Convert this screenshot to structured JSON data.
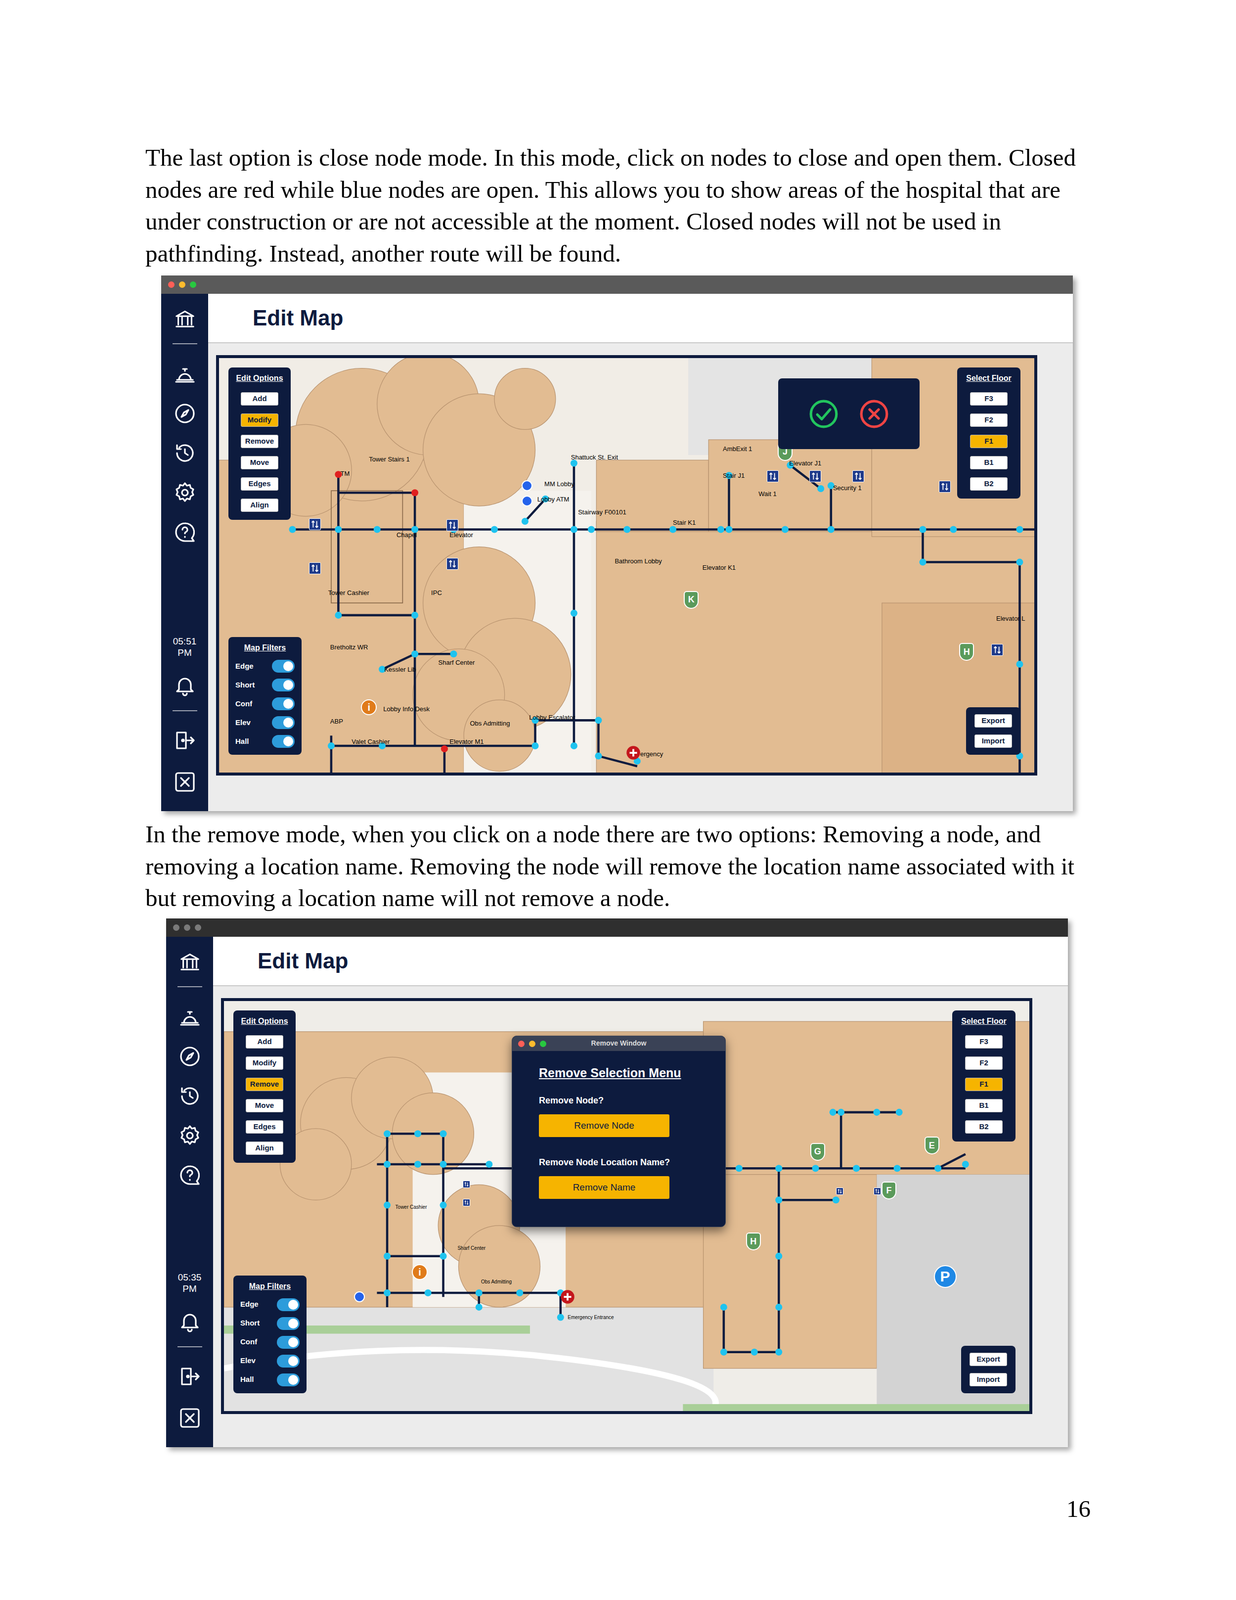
{
  "paragraphs": [
    [
      "The last option is close node mode. In this mode, click on nodes to close and open them. Closed",
      "nodes are red while blue nodes are open. This allows you to show areas of the hospital that are",
      "under construction or are not accessible at the moment. Closed nodes will not be used in",
      "pathfinding. Instead, another route will be found."
    ],
    [
      "In the remove mode, when you click on a node there are two options: Removing a node, and",
      "removing a location name. Removing the node will remove the location name associated with it",
      "but removing a location name will not remove a node."
    ]
  ],
  "screenshots": [
    {
      "active": true,
      "header": "Edit Map",
      "time": "05:51",
      "meridiem": "PM",
      "edit_options": {
        "title": "Edit Options",
        "buttons": [
          {
            "label": "Add",
            "selected": false
          },
          {
            "label": "Modify",
            "selected": true
          },
          {
            "label": "Remove",
            "selected": false
          },
          {
            "label": "Move",
            "selected": false
          },
          {
            "label": "Edges",
            "selected": false
          },
          {
            "label": "Align",
            "selected": false
          }
        ]
      },
      "floors": {
        "title": "Select Floor",
        "buttons": [
          {
            "label": "F3",
            "selected": false
          },
          {
            "label": "F2",
            "selected": false
          },
          {
            "label": "F1",
            "selected": true
          },
          {
            "label": "B1",
            "selected": false
          },
          {
            "label": "B2",
            "selected": false
          }
        ]
      },
      "filters": {
        "title": "Map Filters",
        "items": [
          {
            "label": "Edge",
            "on": true
          },
          {
            "label": "Short",
            "on": true
          },
          {
            "label": "Conf",
            "on": true
          },
          {
            "label": "Elev",
            "on": true
          },
          {
            "label": "Hall",
            "on": true
          }
        ]
      },
      "actions": [
        "Export",
        "Import"
      ],
      "map": {
        "labels": [
          "Tower Stairs 1",
          "TM",
          "Shattuck St. Exit",
          "MM Lobby",
          "Lobby ATM",
          "Stairway F00101",
          "AmbExit 1",
          "Stair J1",
          "Elevator J1",
          "Wait 1",
          "Security 1",
          "Stair K1",
          "Chapel",
          "Elevator",
          "Bathroom Lobby",
          "Elevator K1",
          "Tower Cashier",
          "IPC",
          "Bretholtz WR",
          "Kessler Lib",
          "Sharf Center",
          "Lobby Info Desk",
          "Lobby Escalator",
          "Obs Admitting",
          "ABP",
          "Valet Cashier",
          "Elevator M1",
          "ergency",
          "Elevator L"
        ],
        "pins": [
          {
            "text": "J",
            "kind": "shield",
            "color": "#5b9a5b"
          },
          {
            "text": "K",
            "kind": "shield",
            "color": "#5b9a5b"
          },
          {
            "text": "H",
            "kind": "shield",
            "color": "#5b9a5b"
          },
          {
            "text": "i",
            "kind": "circle",
            "color": "#e07b1a"
          }
        ],
        "nodes": [
          {
            "closed": false
          },
          {
            "closed": false
          },
          {
            "closed": false
          },
          {
            "closed": false
          },
          {
            "closed": false
          },
          {
            "closed": false
          },
          {
            "closed": false
          },
          {
            "closed": false
          },
          {
            "closed": false
          },
          {
            "closed": false
          },
          {
            "closed": false
          },
          {
            "closed": false
          },
          {
            "closed": false
          },
          {
            "closed": false
          },
          {
            "closed": false
          },
          {
            "closed": false
          },
          {
            "closed": false
          },
          {
            "closed": false
          },
          {
            "closed": true
          },
          {
            "closed": true
          },
          {
            "closed": false
          },
          {
            "closed": false
          },
          {
            "closed": false
          },
          {
            "closed": false
          },
          {
            "closed": false
          },
          {
            "closed": false
          },
          {
            "closed": false
          },
          {
            "closed": false
          },
          {
            "closed": true
          },
          {
            "closed": false
          },
          {
            "closed": false
          },
          {
            "closed": false
          },
          {
            "closed": false
          },
          {
            "closed": false
          },
          {
            "closed": false
          },
          {
            "closed": false
          },
          {
            "closed": false
          },
          {
            "closed": false
          },
          {
            "closed": false
          },
          {
            "closed": false
          },
          {
            "closed": false
          },
          {
            "closed": false
          },
          {
            "closed": false
          },
          {
            "closed": false
          },
          {
            "closed": false
          }
        ]
      },
      "overlay": {
        "kind": "confirm"
      }
    },
    {
      "active": false,
      "header": "Edit Map",
      "time": "05:35",
      "meridiem": "PM",
      "edit_options": {
        "title": "Edit Options",
        "buttons": [
          {
            "label": "Add",
            "selected": false
          },
          {
            "label": "Modify",
            "selected": false
          },
          {
            "label": "Remove",
            "selected": true
          },
          {
            "label": "Move",
            "selected": false
          },
          {
            "label": "Edges",
            "selected": false
          },
          {
            "label": "Align",
            "selected": false
          }
        ]
      },
      "floors": {
        "title": "Select Floor",
        "buttons": [
          {
            "label": "F3",
            "selected": false
          },
          {
            "label": "F2",
            "selected": false
          },
          {
            "label": "F1",
            "selected": true
          },
          {
            "label": "B1",
            "selected": false
          },
          {
            "label": "B2",
            "selected": false
          }
        ]
      },
      "filters": {
        "title": "Map Filters",
        "items": [
          {
            "label": "Edge",
            "on": true
          },
          {
            "label": "Short",
            "on": true
          },
          {
            "label": "Conf",
            "on": true
          },
          {
            "label": "Elev",
            "on": true
          },
          {
            "label": "Hall",
            "on": true
          }
        ]
      },
      "actions": [
        "Export",
        "Import"
      ],
      "map": {
        "labels": [
          "Sharf Center",
          "Obs Admitting",
          "Emergency Entrance",
          "Tower Cashier"
        ],
        "pins": [
          {
            "text": "G",
            "kind": "shield",
            "color": "#5b9a5b"
          },
          {
            "text": "E",
            "kind": "shield",
            "color": "#5b9a5b"
          },
          {
            "text": "F",
            "kind": "shield",
            "color": "#5b9a5b"
          },
          {
            "text": "H",
            "kind": "shield",
            "color": "#5b9a5b"
          },
          {
            "text": "i",
            "kind": "circle",
            "color": "#e07b1a"
          },
          {
            "text": "P",
            "kind": "parking",
            "color": "#1e88e5"
          }
        ],
        "nodes": [
          {
            "closed": false
          },
          {
            "closed": false
          },
          {
            "closed": false
          },
          {
            "closed": false
          },
          {
            "closed": false
          },
          {
            "closed": false
          },
          {
            "closed": false
          },
          {
            "closed": false
          },
          {
            "closed": false
          },
          {
            "closed": false
          },
          {
            "closed": false
          },
          {
            "closed": false
          },
          {
            "closed": false
          },
          {
            "closed": false
          },
          {
            "closed": false
          },
          {
            "closed": false
          },
          {
            "closed": false
          },
          {
            "closed": false
          },
          {
            "closed": false
          },
          {
            "closed": false
          },
          {
            "closed": false
          },
          {
            "closed": false
          },
          {
            "closed": false
          },
          {
            "closed": false
          },
          {
            "closed": false
          },
          {
            "closed": false
          },
          {
            "closed": false
          },
          {
            "closed": false
          },
          {
            "closed": false
          },
          {
            "closed": false
          },
          {
            "closed": false
          },
          {
            "closed": false
          },
          {
            "closed": false
          },
          {
            "closed": false
          },
          {
            "closed": false
          },
          {
            "closed": false
          },
          {
            "closed": false
          }
        ]
      },
      "overlay": {
        "kind": "window",
        "active": true,
        "title": "Remove Window",
        "heading": "Remove Selection Menu",
        "questions": [
          {
            "text": "Remove Node?",
            "button": "Remove Node"
          },
          {
            "text": "Remove Node Location Name?",
            "button": "Remove Name"
          }
        ]
      }
    }
  ],
  "page_number": "16"
}
